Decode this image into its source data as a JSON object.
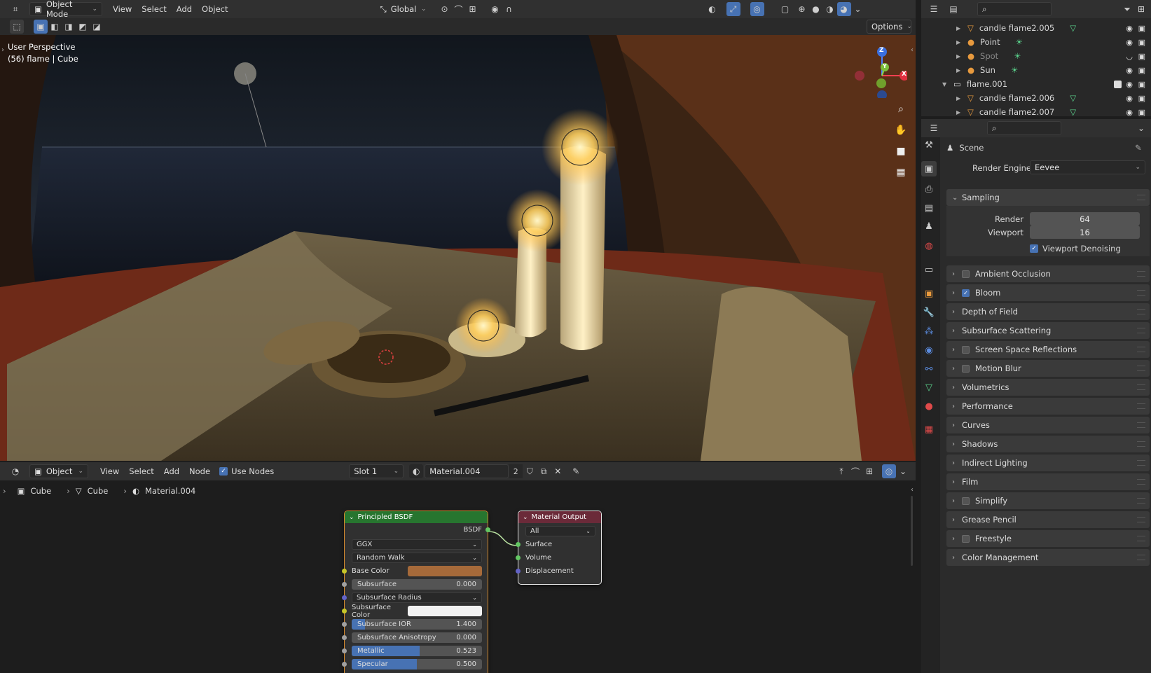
{
  "viewport_header": {
    "mode": "Object Mode",
    "menus": [
      "View",
      "Select",
      "Add",
      "Object"
    ],
    "orientation": "Global",
    "options_label": "Options"
  },
  "viewport": {
    "perspective": "User Perspective",
    "context": "(56) flame | Cube",
    "gizmo": {
      "z": "Z",
      "y": "Y",
      "x": "X"
    }
  },
  "node_header": {
    "type": "Object",
    "menus": [
      "View",
      "Select",
      "Add",
      "Node"
    ],
    "use_nodes_label": "Use Nodes",
    "slot": "Slot 1",
    "material": "Material.004",
    "users": "2"
  },
  "breadcrumb": {
    "object": "Cube",
    "mesh": "Cube",
    "material": "Material.004"
  },
  "bsdf_node": {
    "title": "Principled BSDF",
    "output": "BSDF",
    "distribution": "GGX",
    "subsurface_method": "Random Walk",
    "base_color_label": "Base Color",
    "base_color": "#a66a3a",
    "subsurface_label": "Subsurface",
    "subsurface_value": "0.000",
    "subsurface_radius_label": "Subsurface Radius",
    "subsurface_color_label": "Subsurface Color",
    "subsurface_ior_label": "Subsurface IOR",
    "subsurface_ior_value": "1.400",
    "subsurface_anisotropy_label": "Subsurface Anisotropy",
    "subsurface_anisotropy_value": "0.000",
    "metallic_label": "Metallic",
    "metallic_value": "0.523",
    "specular_label": "Specular",
    "specular_value": "0.500"
  },
  "output_node": {
    "title": "Material Output",
    "target": "All",
    "inputs": [
      "Surface",
      "Volume",
      "Displacement"
    ]
  },
  "outliner": {
    "rows": [
      {
        "name": "candle flame2.005",
        "type": "mesh"
      },
      {
        "name": "Point",
        "type": "light"
      },
      {
        "name": "Spot",
        "type": "light"
      },
      {
        "name": "Sun",
        "type": "light"
      },
      {
        "name": "flame.001",
        "type": "collection"
      },
      {
        "name": "candle flame2.006",
        "type": "mesh"
      },
      {
        "name": "candle flame2.007",
        "type": "mesh"
      }
    ]
  },
  "properties": {
    "scene_label": "Scene",
    "render_engine_label": "Render Engine",
    "render_engine": "Eevee",
    "sampling": {
      "title": "Sampling",
      "render_label": "Render",
      "render_value": "64",
      "viewport_label": "Viewport",
      "viewport_value": "16",
      "denoise_label": "Viewport Denoising"
    },
    "panels": [
      {
        "label": "Ambient Occlusion",
        "checkbox": true,
        "checked": false
      },
      {
        "label": "Bloom",
        "checkbox": true,
        "checked": true
      },
      {
        "label": "Depth of Field",
        "checkbox": false
      },
      {
        "label": "Subsurface Scattering",
        "checkbox": false
      },
      {
        "label": "Screen Space Reflections",
        "checkbox": true,
        "checked": false
      },
      {
        "label": "Motion Blur",
        "checkbox": true,
        "checked": false
      },
      {
        "label": "Volumetrics",
        "checkbox": false
      },
      {
        "label": "Performance",
        "checkbox": false
      },
      {
        "label": "Curves",
        "checkbox": false
      },
      {
        "label": "Shadows",
        "checkbox": false
      },
      {
        "label": "Indirect Lighting",
        "checkbox": false
      },
      {
        "label": "Film",
        "checkbox": false
      },
      {
        "label": "Simplify",
        "checkbox": true,
        "checked": false
      },
      {
        "label": "Grease Pencil",
        "checkbox": false
      },
      {
        "label": "Freestyle",
        "checkbox": true,
        "checked": false
      },
      {
        "label": "Color Management",
        "checkbox": false
      }
    ]
  },
  "colors": {
    "accent": "#4772b3",
    "bsdf_header": "#27752f",
    "output_header": "#6b2a39"
  }
}
